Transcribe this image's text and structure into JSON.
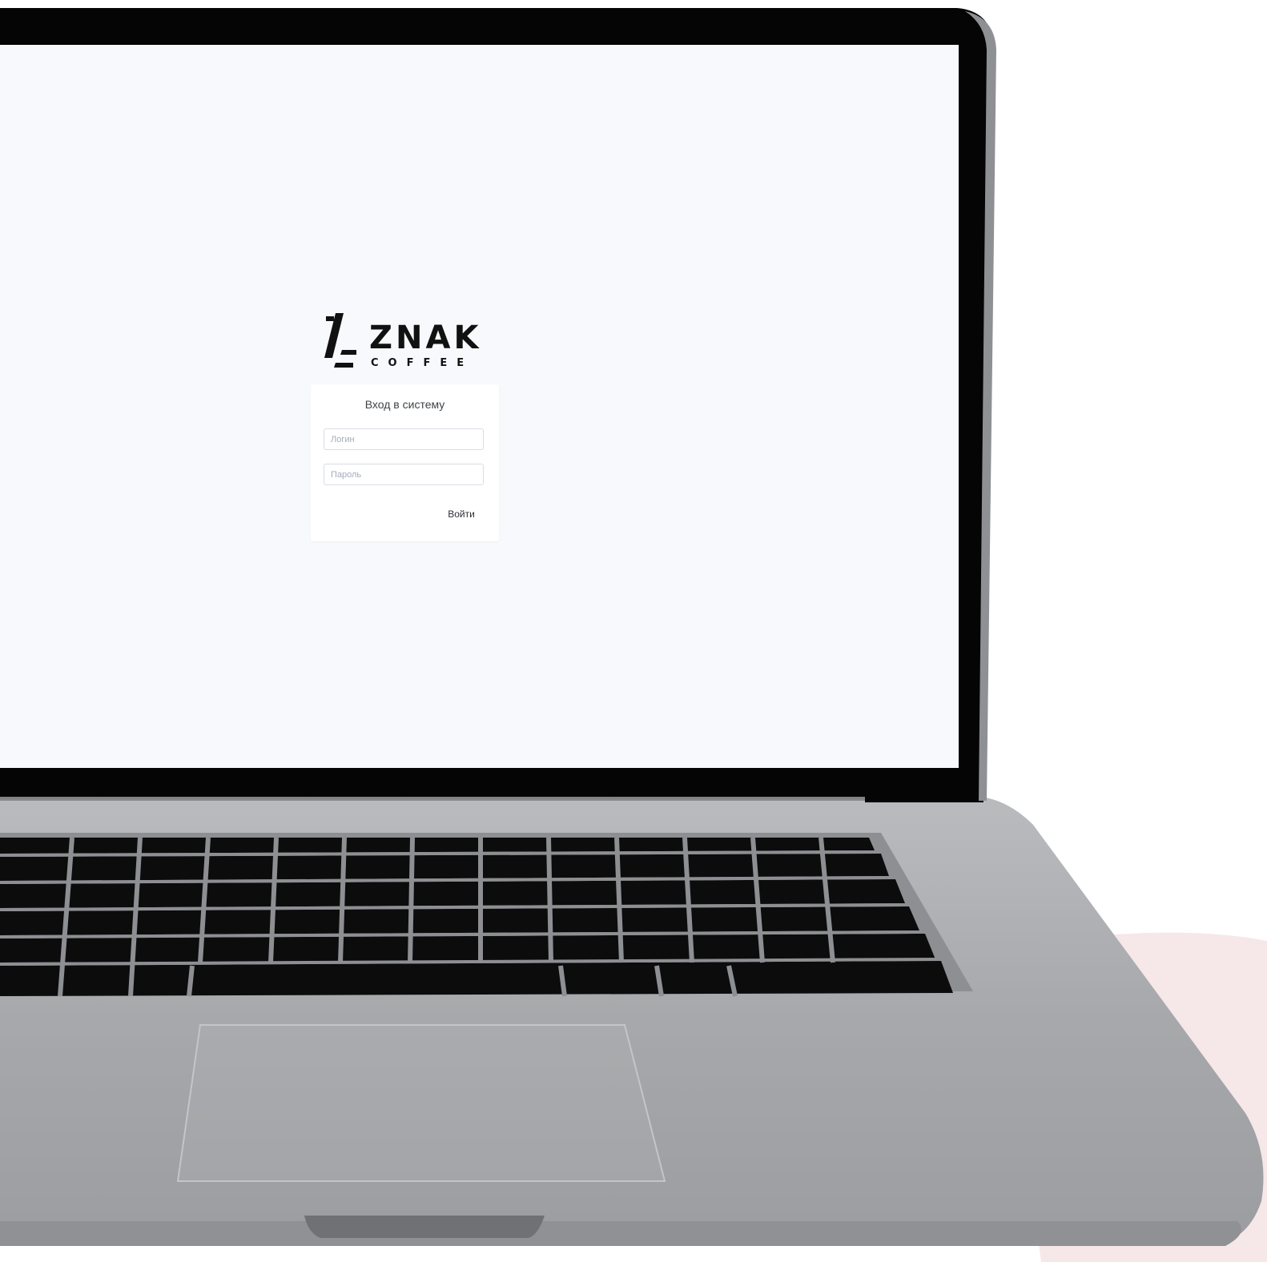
{
  "logo": {
    "brand": "ZNAK",
    "subtitle": "COFFEE"
  },
  "login_form": {
    "title": "Вход в систему",
    "login_placeholder": "Логин",
    "password_placeholder": "Пароль",
    "submit_label": "Войти"
  },
  "colors": {
    "screen_background": "#f7f9fc",
    "card_background": "#ffffff",
    "laptop_bezel": "#050505",
    "laptop_body": "#a9abae",
    "keys": "#0c0c0d",
    "accent_blush": "#f6e7e8"
  }
}
